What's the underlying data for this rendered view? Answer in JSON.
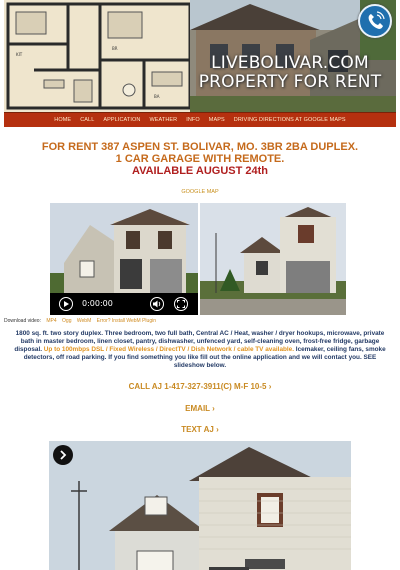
{
  "banner": {
    "title_line1": "LIVEBOLIVAR.COM",
    "title_line2": "PROPERTY FOR RENT",
    "phone_icon": "phone-icon"
  },
  "nav": {
    "items": [
      "HOME",
      "CALL",
      "APPLICATION",
      "WEATHER",
      "INFO",
      "MAPS",
      "DRIVING DIRECTIONS AT GOOGLE MAPS"
    ]
  },
  "listing": {
    "headline_line1": "FOR RENT 387 ASPEN ST. BOLIVAR, MO. 3BR 2BA DUPLEX.",
    "headline_line2": "1 CAR GARAGE WITH REMOTE.",
    "available": "AVAILABLE AUGUST 24th",
    "map_link": "GOOGLE MAP"
  },
  "video": {
    "time": "0:00:00",
    "download_label": "Download video:",
    "download_links": [
      "MP4",
      "Ogg",
      "WebM",
      "Error? Install WebM Plugin"
    ]
  },
  "description": {
    "part1": "1800 sq. ft. two story duplex. Three bedroom, two full bath, Central AC / Heat, washer / dryer hookups, microwave, private bath in master bedroom, linen closet, pantry, dishwasher, unfenced yard, self-cleaning oven, frost-free fridge, garbage disposal. ",
    "highlight": "Up to 100mbps DSL / Fixed Wireless / DirectTV / Dish Network / cable TV available.",
    "part2": " Icemaker, ceiling fans, smoke detectors, off road parking. If you find something you like fill out the online application and we will contact you. SEE slideshow below."
  },
  "contact": {
    "call": "CALL AJ 1-417-327-3911(C) M-F 10-5 ›",
    "email": "EMAIL ›",
    "text": "TEXT AJ ›"
  },
  "colors": {
    "nav_bg": "#b5300f",
    "heading": "#c56a1c",
    "available": "#b01f1f",
    "link": "#c98a22",
    "description": "#243b66"
  }
}
